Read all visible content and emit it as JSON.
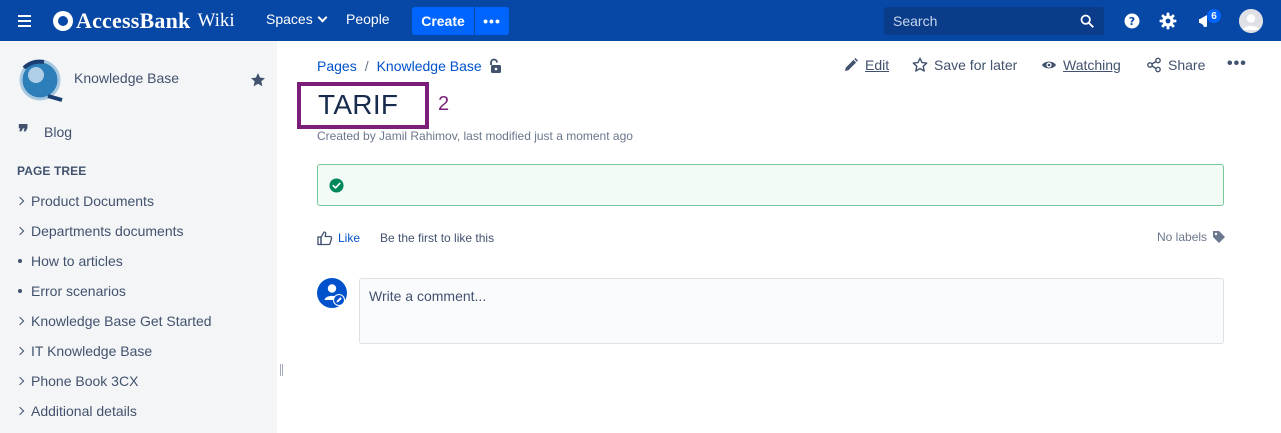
{
  "header": {
    "logo_text": "AccessBank",
    "logo_wiki": "Wiki",
    "spaces_label": "Spaces",
    "people_label": "People",
    "create_label": "Create",
    "create_more_label": "•••",
    "search_placeholder": "Search",
    "notifications_count": "6",
    "icons": [
      "menu-icon",
      "search-icon",
      "help-icon",
      "gear-icon",
      "notification-icon",
      "avatar"
    ]
  },
  "sidebar": {
    "space_name": "Knowledge Base",
    "blog_label": "Blog",
    "page_tree_title": "PAGE TREE",
    "items": [
      {
        "label": "Product Documents",
        "marker": "chevron"
      },
      {
        "label": "Departments documents",
        "marker": "chevron"
      },
      {
        "label": "How to articles",
        "marker": "bullet"
      },
      {
        "label": "Error scenarios",
        "marker": "bullet"
      },
      {
        "label": "Knowledge Base Get Started",
        "marker": "chevron"
      },
      {
        "label": "IT Knowledge Base",
        "marker": "chevron"
      },
      {
        "label": "Phone Book 3CX",
        "marker": "chevron"
      },
      {
        "label": "Additional details",
        "marker": "chevron"
      }
    ]
  },
  "breadcrumb": {
    "items": [
      "Pages",
      "Knowledge Base"
    ],
    "separator": "/"
  },
  "actions": {
    "edit": "Edit",
    "save_for_later": "Save for later",
    "watching": "Watching",
    "share": "Share",
    "more": "•••"
  },
  "page": {
    "title": "TARIF",
    "annotation_number": "2",
    "byline": "Created by Jamil Rahimov, last modified just a moment ago"
  },
  "feedback": {
    "like_label": "Like",
    "like_text": "Be the first to like this",
    "labels_text": "No labels"
  },
  "comment": {
    "placeholder": "Write a comment..."
  },
  "colors": {
    "header_bg": "#0747a6",
    "create_btn": "#0065ff",
    "sidebar_bg": "#f4f5f7",
    "link": "#0052cc",
    "annotation": "#7b1e7a",
    "success_border": "#79c89a",
    "success_icon": "#00875a"
  }
}
